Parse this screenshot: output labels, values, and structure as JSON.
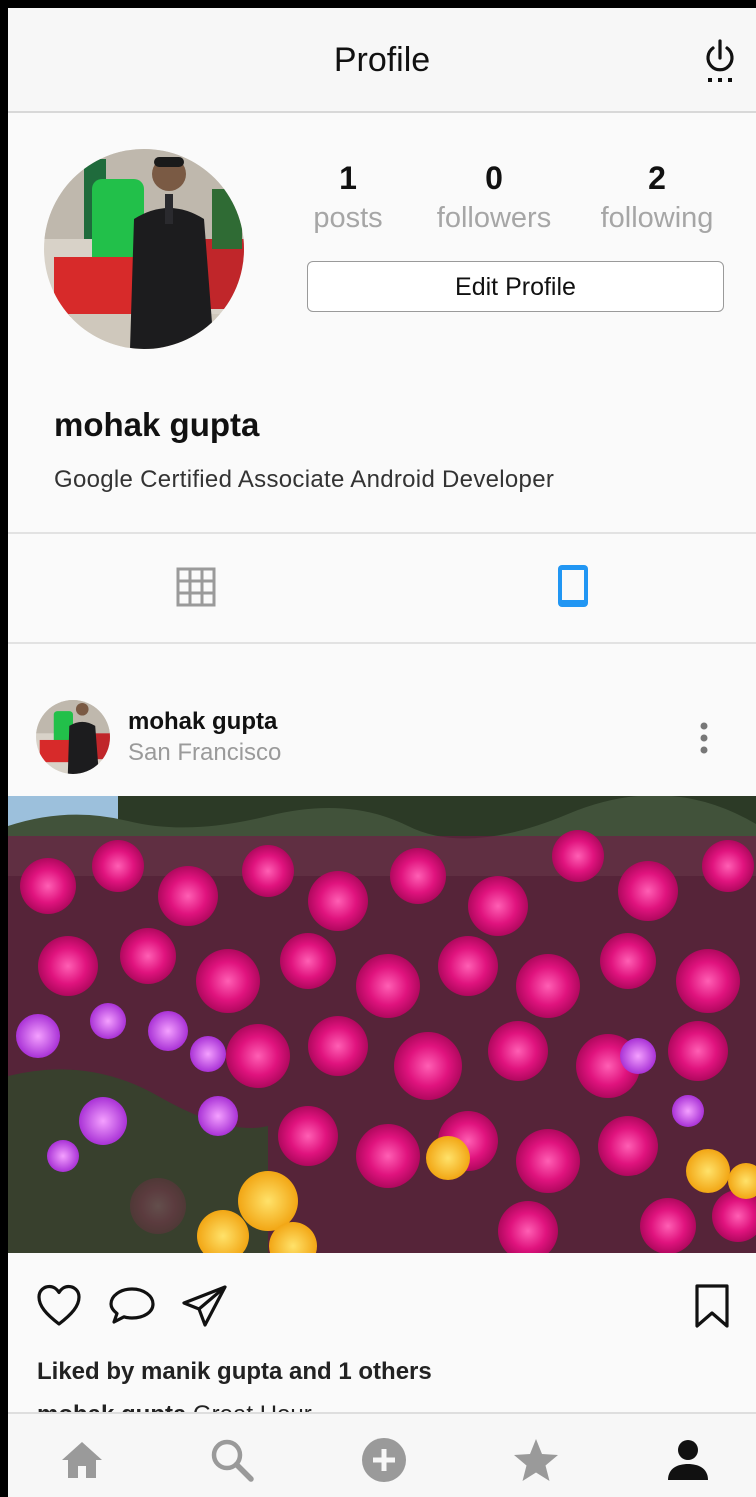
{
  "header": {
    "title": "Profile",
    "power_icon": "power-icon"
  },
  "profile": {
    "stats": [
      {
        "count": "1",
        "label": "posts"
      },
      {
        "count": "0",
        "label": "followers"
      },
      {
        "count": "2",
        "label": "following"
      }
    ],
    "edit_label": "Edit Profile",
    "name": "mohak gupta",
    "bio": "Google Certified Associate Android Developer"
  },
  "tabs": [
    {
      "icon": "grid-icon",
      "active": false
    },
    {
      "icon": "phone-feed-icon",
      "active": true
    }
  ],
  "post": {
    "username": "mohak gupta",
    "location": "San Francisco",
    "liked_by": "Liked by manik gupta and 1 others",
    "caption_user": "mohak gupta",
    "caption_text": "Great Hour"
  },
  "bottom_nav": [
    "home-icon",
    "search-icon",
    "add-circle-icon",
    "star-icon",
    "profile-icon"
  ],
  "colors": {
    "accent": "#2196f3",
    "muted_text": "#a6a6a6",
    "icon_gray": "#9a9a9a",
    "header_bg": "#f7f7f7",
    "page_bg": "#fafafa"
  }
}
